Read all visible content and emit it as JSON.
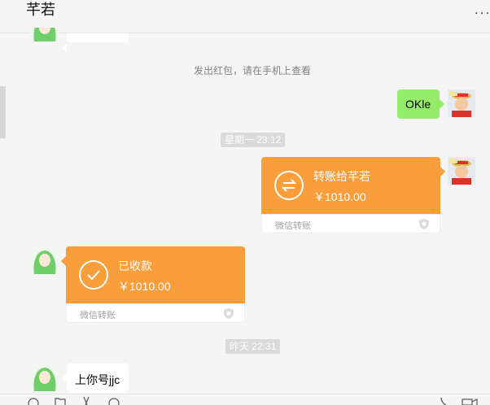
{
  "header": {
    "title": "芊若",
    "more_icon": "more-icon"
  },
  "messages": {
    "system_notice": "发出红包，请在手机上查看",
    "sent_text": "OKle",
    "time1": "星期一 23:12",
    "transfer_sent": {
      "title": "转账给芊若",
      "amount": "￥1010.00",
      "footer": "微信转账"
    },
    "transfer_received": {
      "title": "已收款",
      "amount": "￥1010.00",
      "footer": "微信转账"
    },
    "time2": "昨天 22:31",
    "received_text": "上你号jjc"
  },
  "colors": {
    "transfer_orange": "#fa9d3b",
    "sent_bubble_green": "#95ec69",
    "background": "#f5f5f5"
  },
  "toolbar": {
    "icons": [
      "emoji-icon",
      "folder-icon",
      "scissors-icon",
      "chat-history-icon",
      "phone-icon",
      "video-call-icon"
    ]
  }
}
